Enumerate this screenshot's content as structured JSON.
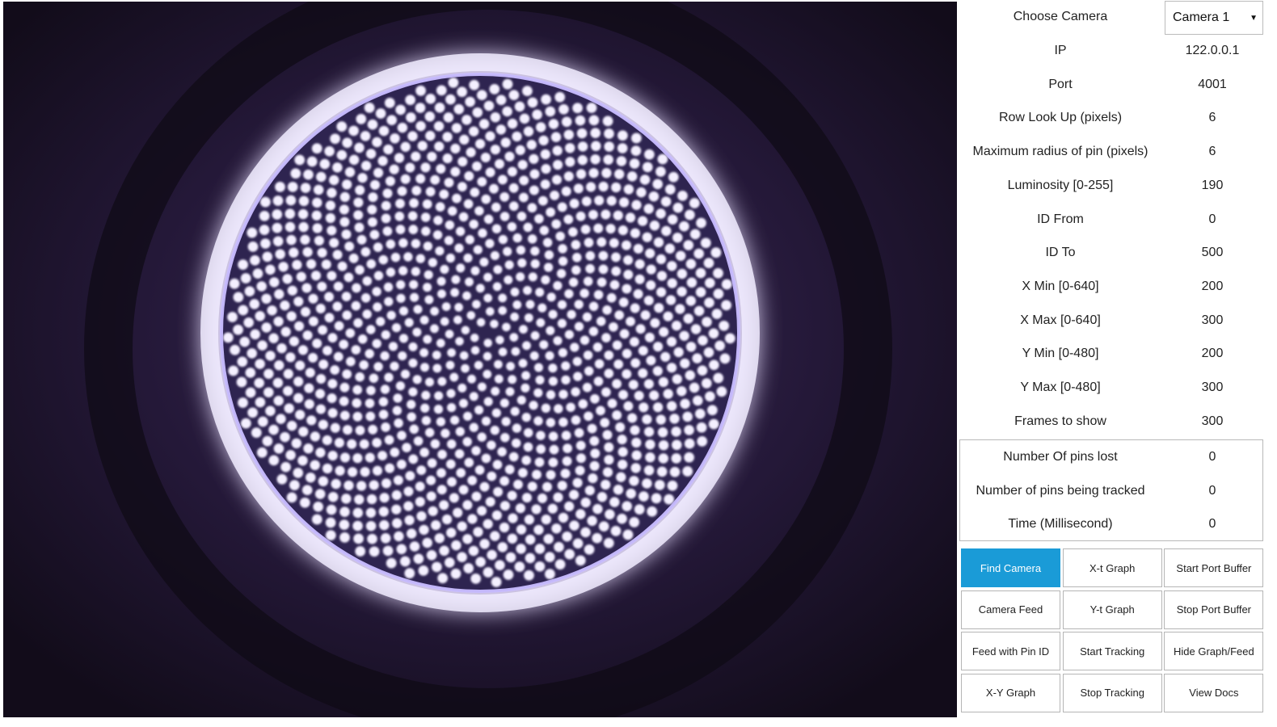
{
  "camera": {
    "label": "Choose Camera",
    "selected": "Camera 1"
  },
  "settings": [
    {
      "label": "IP",
      "value": "122.0.0.1"
    },
    {
      "label": "Port",
      "value": "4001"
    },
    {
      "label": "Row Look Up (pixels)",
      "value": "6"
    },
    {
      "label": "Maximum radius of pin (pixels)",
      "value": "6"
    },
    {
      "label": "Luminosity [0-255]",
      "value": "190"
    },
    {
      "label": "ID From",
      "value": "0"
    },
    {
      "label": "ID To",
      "value": "500"
    },
    {
      "label": "X Min [0-640]",
      "value": "200"
    },
    {
      "label": "X Max [0-640]",
      "value": "300"
    },
    {
      "label": "Y Min [0-480]",
      "value": "200"
    },
    {
      "label": "Y Max [0-480]",
      "value": "300"
    },
    {
      "label": "Frames to show",
      "value": "300"
    }
  ],
  "stats": [
    {
      "label": "Number Of pins lost",
      "value": "0"
    },
    {
      "label": "Number of pins being tracked",
      "value": "0"
    },
    {
      "label": "Time (Millisecond)",
      "value": "0"
    }
  ],
  "buttons": [
    [
      "Find Camera",
      "X-t Graph",
      "Start Port Buffer"
    ],
    [
      "Camera Feed",
      "Y-t Graph",
      "Stop Port Buffer"
    ],
    [
      "Feed with Pin ID",
      "Start Tracking",
      "Hide Graph/Feed"
    ],
    [
      "X-Y Graph",
      "Stop Tracking",
      "View Docs"
    ]
  ],
  "colors": {
    "primary_button": "#1a9bd7",
    "feed_background": "#1a1224",
    "pin_glow": "#b8a8ff"
  }
}
